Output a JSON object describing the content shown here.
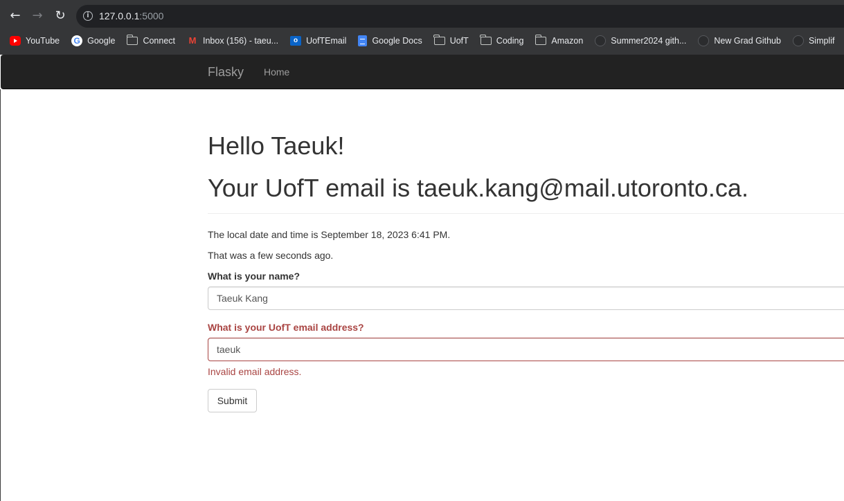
{
  "browser": {
    "url_host": "127.0.0.1",
    "url_port": ":5000",
    "back_icon": "back-arrow-icon",
    "forward_icon": "forward-arrow-icon",
    "reload_icon": "reload-icon"
  },
  "bookmarks": [
    {
      "label": "YouTube",
      "icon": "youtube-icon"
    },
    {
      "label": "Google",
      "icon": "google-icon"
    },
    {
      "label": "Connect",
      "icon": "folder-icon"
    },
    {
      "label": "Inbox (156) - taeu...",
      "icon": "gmail-icon"
    },
    {
      "label": "UofTEmail",
      "icon": "outlook-icon"
    },
    {
      "label": "Google Docs",
      "icon": "google-docs-icon"
    },
    {
      "label": "UofT",
      "icon": "folder-icon"
    },
    {
      "label": "Coding",
      "icon": "folder-icon"
    },
    {
      "label": "Amazon",
      "icon": "folder-icon"
    },
    {
      "label": "Summer2024 gith...",
      "icon": "github-icon"
    },
    {
      "label": "New Grad Github",
      "icon": "github-icon"
    },
    {
      "label": "Simplif",
      "icon": "github-icon"
    }
  ],
  "navbar": {
    "brand": "Flasky",
    "home": "Home"
  },
  "page": {
    "greeting": "Hello Taeuk!",
    "email_heading": "Your UofT email is taeuk.kang@mail.utoronto.ca.",
    "local_time": "The local date and time is September 18, 2023 6:41 PM.",
    "relative_time": "That was a few seconds ago."
  },
  "form": {
    "name_label": "What is your name?",
    "name_value": "Taeuk Kang",
    "email_label": "What is your UofT email address?",
    "email_value": "taeuk",
    "email_error": "Invalid email address.",
    "submit_label": "Submit"
  },
  "colors": {
    "error": "#a94442",
    "navbar_bg": "#222222",
    "chrome_bg": "#353638"
  }
}
